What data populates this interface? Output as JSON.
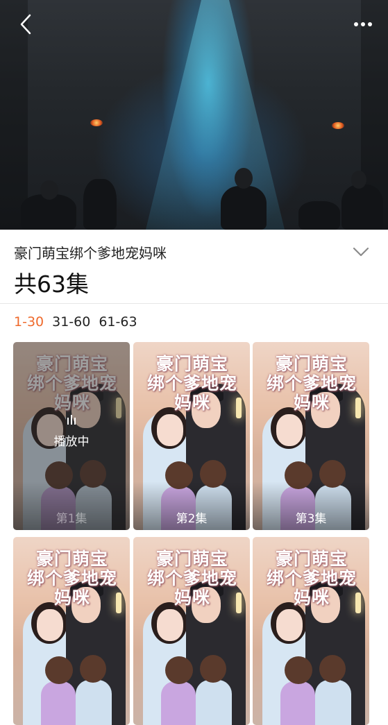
{
  "header": {
    "back_icon": "chevron-left-icon",
    "more_icon": "more-dots-icon"
  },
  "drama": {
    "title": "豪门萌宝绑个爹地宠妈咪",
    "episode_count": "共63集",
    "expand_icon": "chevron-down-icon"
  },
  "ranges": [
    {
      "label": "1-30",
      "active": true
    },
    {
      "label": "31-60",
      "active": false
    },
    {
      "label": "61-63",
      "active": false
    }
  ],
  "episodes": [
    {
      "label": "第1集",
      "playing": true
    },
    {
      "label": "第2集",
      "playing": false
    },
    {
      "label": "第3集",
      "playing": false
    },
    {
      "label": "",
      "playing": false
    },
    {
      "label": "",
      "playing": false
    },
    {
      "label": "",
      "playing": false
    }
  ],
  "poster": {
    "title_line1": "豪门萌宝",
    "title_line2": "绑个爹地宠妈咪"
  },
  "playing_label": "播放中",
  "colors": {
    "accent": "#ef6a2c"
  }
}
